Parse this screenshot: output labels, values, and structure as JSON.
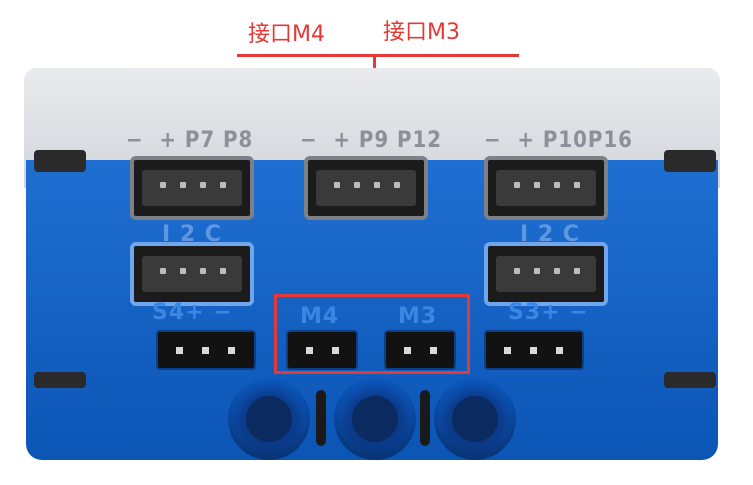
{
  "callouts": {
    "m4": "接口M4",
    "m3": "接口M3"
  },
  "device": {
    "ports_top": [
      {
        "labels": [
          "−",
          "+",
          "P7",
          "P8"
        ]
      },
      {
        "labels": [
          "−",
          "+",
          "P9",
          "P12"
        ]
      },
      {
        "labels": [
          "−",
          "+",
          "P10",
          "P16"
        ]
      }
    ],
    "i2c_labels": [
      "I 2 C",
      "I 2 C"
    ],
    "servo_labels": [
      "S4+ −",
      "S3+ −"
    ],
    "motor_labels": [
      "M4",
      "M3"
    ]
  },
  "colors": {
    "callout": "#e53935",
    "body_blue": "#1565c0",
    "shell_gray": "#dcdfe3"
  }
}
